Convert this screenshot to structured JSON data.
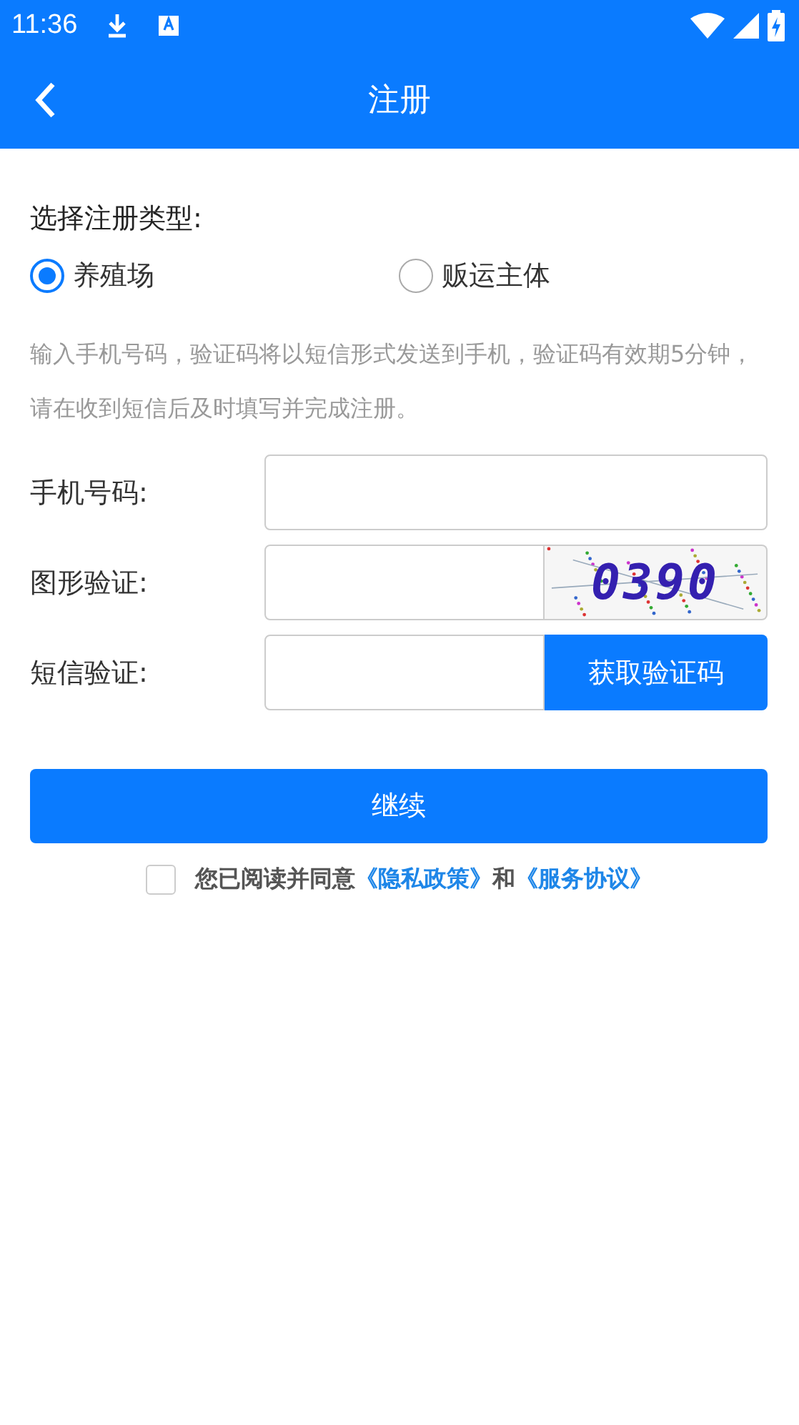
{
  "status_bar": {
    "time": "11:36"
  },
  "app_bar": {
    "title": "注册"
  },
  "type_section": {
    "label": "选择注册类型:",
    "options": [
      {
        "label": "养殖场",
        "selected": true
      },
      {
        "label": "贩运主体",
        "selected": false
      }
    ]
  },
  "hint": "输入手机号码，验证码将以短信形式发送到手机，验证码有效期5分钟，请在收到短信后及时填写并完成注册。",
  "fields": [
    {
      "kind": "input",
      "label": "手机号码:"
    },
    {
      "kind": "captcha",
      "label": "图形验证:",
      "captcha": "0390"
    },
    {
      "kind": "sms",
      "label": "短信验证:",
      "button": "获取验证码"
    }
  ],
  "continue_button": "继续",
  "agreement": {
    "checked": false,
    "parts": [
      {
        "kind": "text",
        "text": "您已阅读并同意"
      },
      {
        "kind": "link",
        "text": "《隐私政策》"
      },
      {
        "kind": "text",
        "text": "和"
      },
      {
        "kind": "link",
        "text": "《服务协议》"
      }
    ]
  }
}
